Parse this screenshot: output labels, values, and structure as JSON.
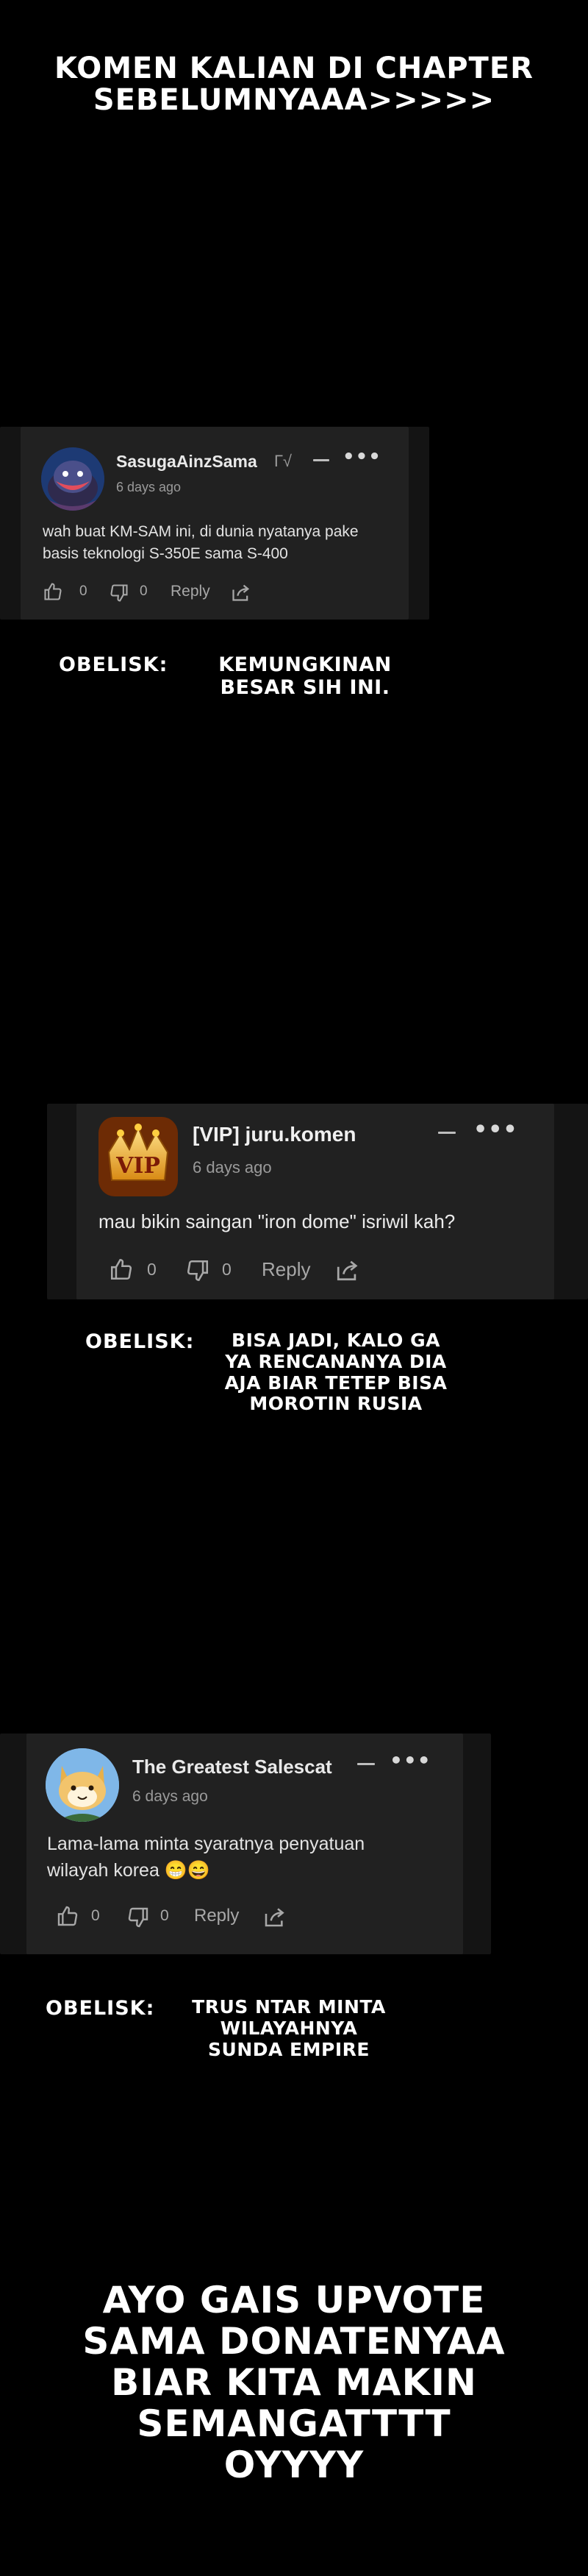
{
  "header": {
    "title": "KOMEN KALIAN DI CHAPTER\nSEBELUMNYAAA>>>>>"
  },
  "comments": [
    {
      "username": "SasugaAinzSama",
      "username_suffix": "Г√",
      "time": "6 days ago",
      "text": "wah buat KM-SAM ini, di dunia nyatanya pake basis teknologi S-350E sama S-400",
      "likes": "0",
      "dislikes": "0",
      "reply_label": "Reply",
      "avatar_icon": "anime-character-avatar"
    },
    {
      "username": "[VIP] juru.komen",
      "time": "6 days ago",
      "text": "mau bikin saingan \"iron dome\" isriwil kah?",
      "likes": "0",
      "dislikes": "0",
      "reply_label": "Reply",
      "avatar_badge": "VIP",
      "avatar_icon": "vip-crown-avatar"
    },
    {
      "username": "The Greatest Salescat",
      "time": "6 days ago",
      "text": "Lama-lama minta syaratnya penyatuan wilayah korea 😁😄",
      "likes": "0",
      "dislikes": "0",
      "reply_label": "Reply",
      "avatar_icon": "cat-avatar"
    }
  ],
  "responses": [
    {
      "speaker": "OBELISK:",
      "text": "KEMUNGKINAN\nBESAR SIH INI."
    },
    {
      "speaker": "OBELISK:",
      "text": "BISA JADI, KALO GA\nYA RENCANANYA DIA\nAJA BIAR TETEP BISA\nMOROTIN RUSIA"
    },
    {
      "speaker": "OBELISK:",
      "text": "TRUS NTAR MINTA\nWILAYAHNYA\nSUNDA EMPIRE"
    }
  ],
  "footer": {
    "text": "AYO GAIS UPVOTE\nSAMA DONATENYAA\nBIAR KITA MAKIN\nSEMANGATTTT\nOYYYY"
  },
  "colors": {
    "background": "#000000",
    "card": "#212121",
    "text": "#e3e3e3",
    "muted": "#9a9a9a"
  }
}
